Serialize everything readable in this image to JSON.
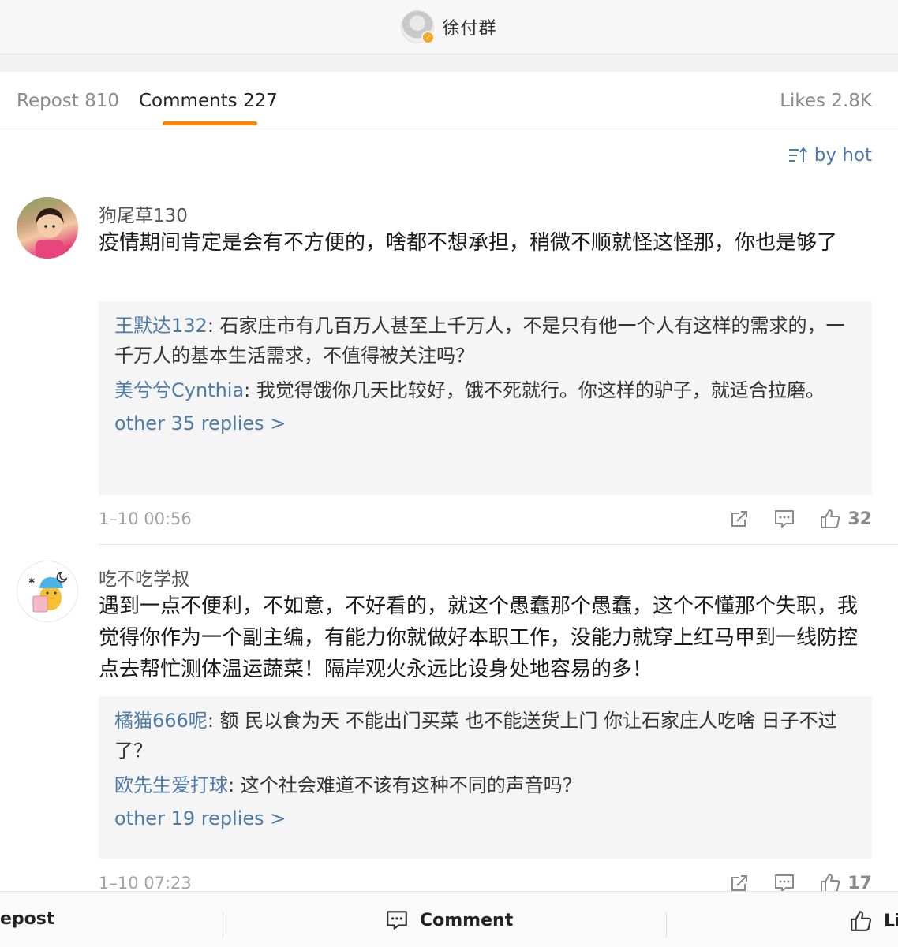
{
  "header": {
    "title": "徐付群",
    "verified_icon": "verified-badge-icon"
  },
  "tabs": {
    "repost": "Repost 810",
    "comments": "Comments 227",
    "likes": "Likes 2.8K"
  },
  "sort": {
    "label": "by hot",
    "icon": "sort-icon"
  },
  "comments": [
    {
      "name": "狗尾草130",
      "text": "疫情期间肯定是会有不方便的，啥都不想承担，稍微不顺就怪这怪那，你也是够了",
      "replies": [
        {
          "name": "王默达132",
          "text": ": 石家庄市有几百万人甚至上千万人，不是只有他一个人有这样的需求的，一千万人的基本生活需求，不值得被关注吗？"
        },
        {
          "name": "美兮兮Cynthia",
          "text": ": 我觉得饿你几天比较好，饿不死就行。你这样的驴子，就适合拉磨。"
        }
      ],
      "more": "other 35 replies >",
      "time": "1–10 00:56",
      "likes": "32"
    },
    {
      "name": "吃不吃学叔",
      "text": "遇到一点不便利，不如意，不好看的，就这个愚蠢那个愚蠢，这个不懂那个失职，我觉得你作为一个副主编，有能力你就做好本职工作，没能力就穿上红马甲到一线防控点去帮忙测体温运蔬菜！隔岸观火永远比设身处地容易的多！",
      "replies": [
        {
          "name": "橘猫666呢",
          "text": ": 额 民以食为天 不能出门买菜 也不能送货上门 你让石家庄人吃啥 日子不过了？"
        },
        {
          "name": "欧先生爱打球",
          "text": ": 这个社会难道不该有这种不同的声音吗？"
        }
      ],
      "more": "other 19 replies >",
      "time": "1–10 07:23",
      "likes": "17"
    }
  ],
  "bottom_bar": {
    "repost": "epost",
    "comment": "Comment",
    "like": "Li"
  },
  "colors": {
    "accent": "#ff8200",
    "link": "#4e7aa8",
    "muted": "#8a8a8a"
  }
}
